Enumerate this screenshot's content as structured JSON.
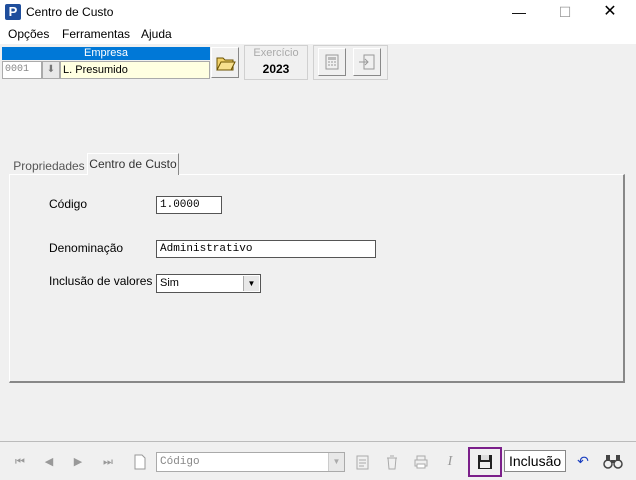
{
  "window": {
    "app_icon_letter": "P",
    "title": "Centro de Custo",
    "minimize": "—",
    "maximize": "☐",
    "close": "✕"
  },
  "menu": {
    "items": [
      "Opções",
      "Ferramentas",
      "Ajuda"
    ]
  },
  "toolbar": {
    "empresa_label": "Empresa",
    "empresa_code": "0001",
    "empresa_lookup_icon": "⬇",
    "empresa_name": "L. Presumido",
    "exercicio_label": "Exercício",
    "exercicio_year": "2023"
  },
  "tabs": [
    {
      "label": "Propriedades"
    },
    {
      "label": "Centro de Custo"
    }
  ],
  "form": {
    "codigo_label": "Código",
    "codigo_value": "1.0000",
    "denominacao_label": "Denominação",
    "denominacao_value": "Administrativo",
    "inclusao_label": "Inclusão de valores ?",
    "inclusao_value": "Sim",
    "dropdown_arrow": "▼"
  },
  "bottom": {
    "nav_first": "⏮",
    "nav_prev": "◀",
    "nav_next": "▶",
    "nav_last": "⏭",
    "search_field": "Código",
    "dropdown_arrow": "▼",
    "italic_btn": "I",
    "mode": "Inclusão",
    "undo_icon": "↶",
    "find_icon": "⚲"
  },
  "colors": {
    "accent": "#0078d7",
    "highlight_border": "#7b1f8a"
  }
}
